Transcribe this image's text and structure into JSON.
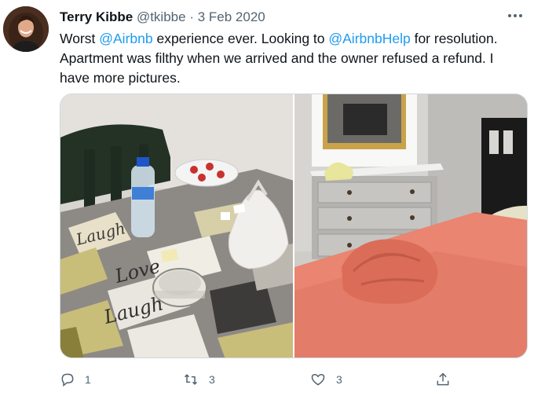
{
  "tweet": {
    "author_name": "Terry Kibbe",
    "handle": "@tkibbe",
    "separator": "·",
    "date": "3 Feb 2020",
    "text_parts": {
      "p1": "Worst ",
      "m1": "@Airbnb",
      "p2": " experience ever. Looking to ",
      "m2": "@AirbnbHelp",
      "p3": " for resolution. Apartment was filthy when we arrived and the owner refused a refund.  I have more pictures."
    },
    "photo_left_text": {
      "laugh_top": "Laugh",
      "love": "Love",
      "laugh_bottom": "Laugh"
    },
    "actions": {
      "reply_count": "1",
      "retweet_count": "3",
      "like_count": "3"
    }
  },
  "icons": [
    "more-icon",
    "reply-icon",
    "retweet-icon",
    "like-icon",
    "share-icon"
  ],
  "colors": {
    "mention": "#1d9bf0",
    "muted": "#536471",
    "text": "#0f1419"
  }
}
